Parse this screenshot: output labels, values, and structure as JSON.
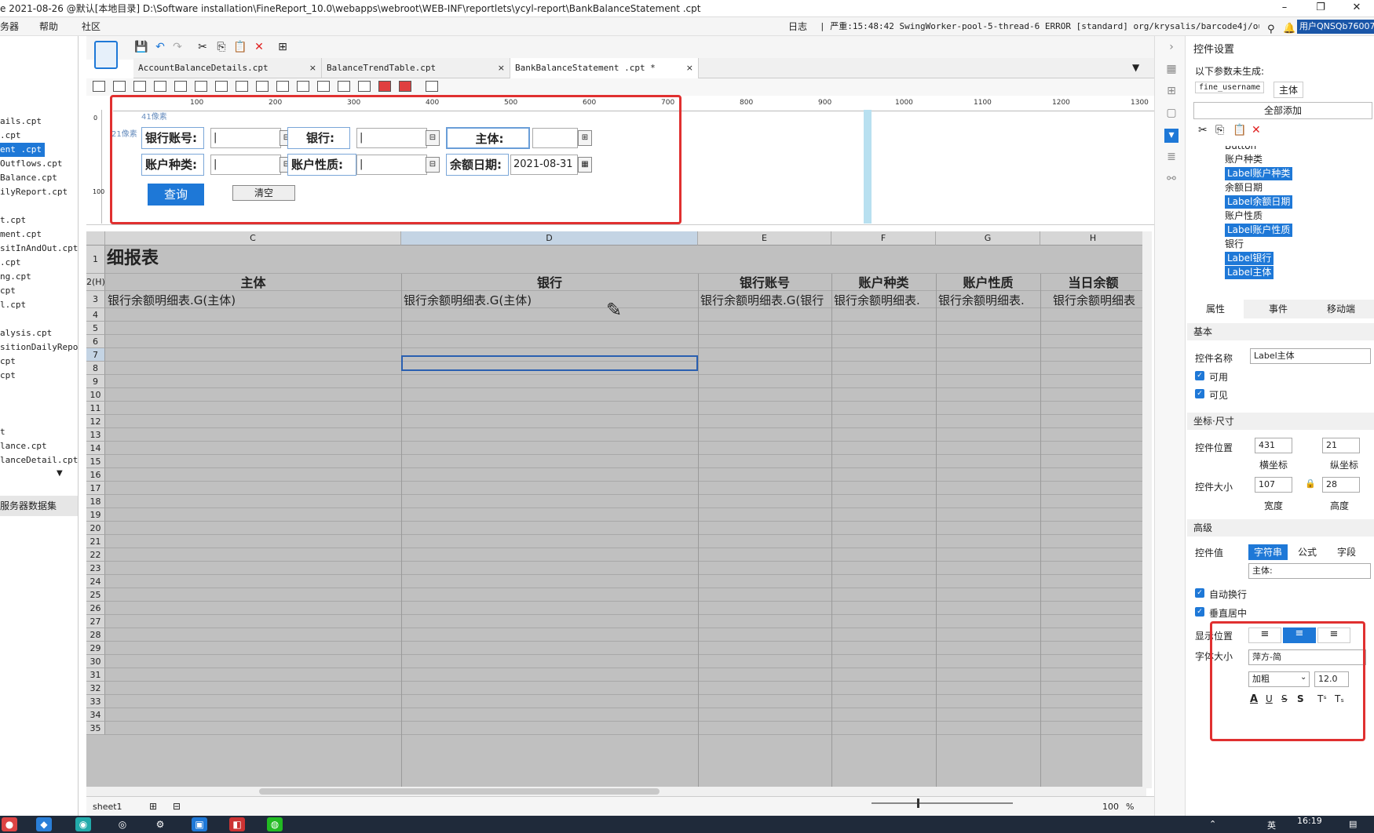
{
  "title": {
    "text": "e 2021-08-26 @默认[本地目录]    D:\\Software installation\\FineReport_10.0\\webapps\\webroot\\WEB-INF\\reportlets\\ycyl-report\\BankBalanceStatement  .cpt"
  },
  "window": {
    "min": "–",
    "restore": "❐",
    "close": "✕"
  },
  "menu": {
    "items": [
      "务器",
      "帮助",
      "社区"
    ]
  },
  "status": {
    "log_label": "日志",
    "log_text": "| 严重:15:48:42 SwingWorker-pool-5-thread-6 ERROR [standard] org/krysalis/barcode4j/output/C...",
    "user": "用户QNSQb760071"
  },
  "left_files": [
    "ails.cpt",
    ".cpt",
    "ent   .cpt",
    "Outflows.cpt",
    "Balance.cpt",
    "ilyReport.cpt",
    "",
    "t.cpt",
    "ment.cpt",
    "sitInAndOut.cpt",
    ".cpt",
    "ng.cpt",
    "cpt",
    "l.cpt",
    "",
    "alysis.cpt",
    "sitionDailyRepo",
    "cpt",
    "cpt",
    "",
    "",
    "t",
    "lance.cpt",
    "lanceDetail.cpt"
  ],
  "left_server_ds": "服务器数据集",
  "tabs": [
    {
      "label": "AccountBalanceDetails.cpt",
      "close": "×"
    },
    {
      "label": "BalanceTrendTable.cpt",
      "close": "×"
    },
    {
      "label": "BankBalanceStatement   .cpt *",
      "close": "×"
    }
  ],
  "ruler": {
    "marks": [
      "100",
      "200",
      "300",
      "400",
      "500",
      "600",
      "700",
      "800",
      "900",
      "1000",
      "1100",
      "1200",
      "1300"
    ],
    "px41": "41像素",
    "px21": "21像素",
    "v100": "100",
    "v0": "0"
  },
  "form": {
    "bank_account_label": "银行账号:",
    "bank_label": "银行:",
    "entity_label": "主体:",
    "account_type_label": "账户种类:",
    "account_nature_label": "账户性质:",
    "balance_date_label": "余额日期:",
    "balance_date_value": "2021-08-31",
    "query": "查询",
    "clear": "清空"
  },
  "grid": {
    "col_headers": [
      "C",
      "D",
      "E",
      "F",
      "G",
      "H"
    ],
    "title": "细报表",
    "headers": [
      "主体",
      "银行",
      "银行账号",
      "账户种类",
      "账户性质",
      "当日余额"
    ],
    "row3": [
      "银行余额明细表.G(主体)",
      "银行余额明细表.G(主体)",
      "银行余额明细表.G(银行",
      "银行余额明细表.",
      "银行余额明细表.",
      "银行余额明细表"
    ],
    "row_numbers": [
      "1",
      "2(H)",
      "3",
      "4",
      "5",
      "6",
      "7",
      "8",
      "9",
      "10",
      "11",
      "12",
      "13",
      "14",
      "15",
      "16",
      "17",
      "18",
      "19",
      "20",
      "21",
      "22",
      "23",
      "24",
      "25",
      "26",
      "27",
      "28",
      "29",
      "30",
      "31",
      "32",
      "33",
      "34",
      "35"
    ]
  },
  "sheet": {
    "name": "sheet1",
    "zoom": "100",
    "pct": "%"
  },
  "right": {
    "title": "控件设置",
    "params_note": "以下参数未生成:",
    "param1": "fine_username",
    "param2": "主体",
    "add_all": "全部添加",
    "tree": [
      "Button",
      "账户种类",
      "Label账户种类",
      "余额日期",
      "Label余额日期",
      "账户性质",
      "Label账户性质",
      "银行",
      "Label银行",
      "Label主体"
    ],
    "tabs": [
      "属性",
      "事件",
      "移动端"
    ],
    "basic": "基本",
    "name_label": "控件名称",
    "name_value": "Label主体",
    "enabled": "可用",
    "visible": "可见",
    "coord_section": "坐标·尺寸",
    "pos_label": "控件位置",
    "pos_x": "431",
    "pos_y": "21",
    "x_caption": "横坐标",
    "y_caption": "纵坐标",
    "size_label": "控件大小",
    "width": "107",
    "height": "28",
    "w_caption": "宽度",
    "h_caption": "高度",
    "advanced": "高级",
    "value_label": "控件值",
    "value_types": [
      "字符串",
      "公式",
      "字段"
    ],
    "value_text": "主体:",
    "auto_wrap": "自动换行",
    "vcenter": "垂直居中",
    "display_pos": "显示位置",
    "font_size": "字体大小",
    "font_name": "萍方-简",
    "font_weight": "加粗",
    "font_pt": "12.0"
  },
  "taskbar": {
    "time": "16:19",
    "lang": "英"
  }
}
